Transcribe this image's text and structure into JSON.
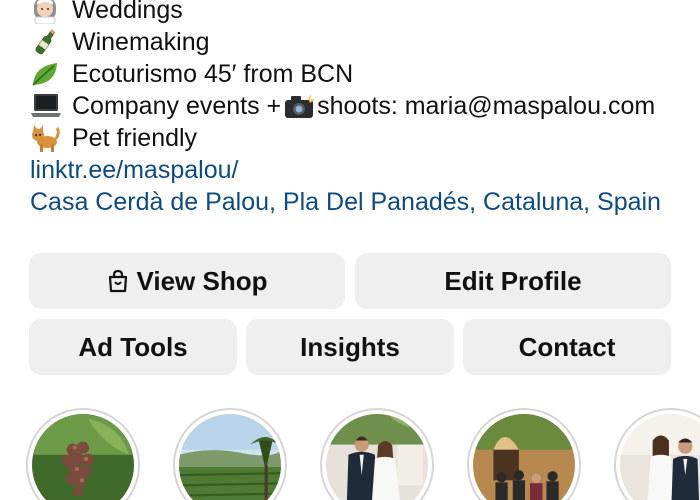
{
  "bio": {
    "lines": [
      {
        "icon": "bride-emoji-icon",
        "text": "Weddings"
      },
      {
        "icon": "wine-bottle-emoji-icon",
        "text": "Winemaking"
      },
      {
        "icon": "leaf-emoji-icon",
        "text": "Ecoturismo 45′ from BCN"
      },
      {
        "icon": "laptop-emoji-icon",
        "text_before": "Company events +",
        "inline_icon": "camera-flash-emoji-icon",
        "text_after": "shoots: maria@maspalou.com"
      },
      {
        "icon": "cat-emoji-icon",
        "text": "Pet friendly"
      }
    ],
    "link": "linktr.ee/maspalou/",
    "location": "Casa Cerdà de Palou, Pla Del Panadés, Cataluna, Spain"
  },
  "buttons": {
    "view_shop": {
      "label": "View Shop",
      "icon": "shopping-bag-icon"
    },
    "edit_profile": {
      "label": "Edit Profile"
    },
    "ad_tools": {
      "label": "Ad Tools"
    },
    "insights": {
      "label": "Insights"
    },
    "contact": {
      "label": "Contact"
    }
  },
  "highlights": [
    {
      "icon": "grapes-highlight-image"
    },
    {
      "icon": "vineyard-landscape-highlight-image"
    },
    {
      "icon": "wedding-couple-highlight-image"
    },
    {
      "icon": "group-event-highlight-image"
    },
    {
      "icon": "couple-portrait-highlight-image"
    }
  ],
  "colors": {
    "link": "#0d4b86",
    "button_bg": "#efefef",
    "text": "#111111",
    "highlight_ring": "#d6d6d6"
  }
}
